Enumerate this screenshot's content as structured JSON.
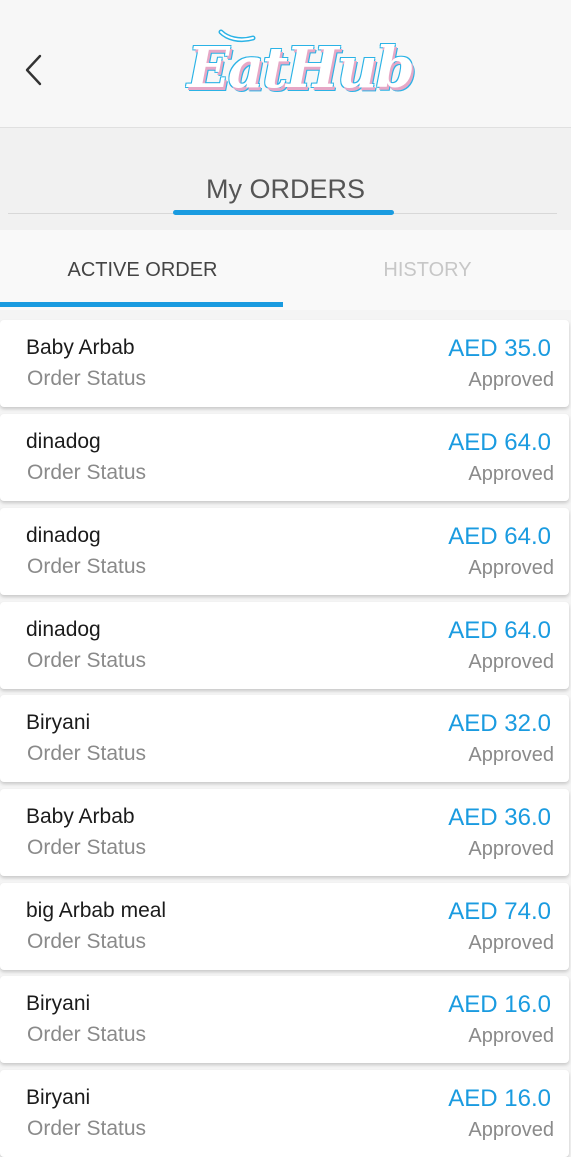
{
  "app": {
    "logo_text": "EatHub"
  },
  "header": {
    "back_icon": "chevron-left-icon"
  },
  "section": {
    "title": "My ORDERS"
  },
  "tabs": [
    {
      "label": "ACTIVE ORDER",
      "active": true
    },
    {
      "label": "HISTORY",
      "active": false
    }
  ],
  "colors": {
    "accent": "#1a9be0",
    "background": "#f4f4f4",
    "card": "#ffffff"
  },
  "orders": [
    {
      "name": "Baby Arbab",
      "status_label": "Order Status",
      "price": "AED 35.0",
      "status": "Approved"
    },
    {
      "name": "dinadog",
      "status_label": "Order Status",
      "price": "AED 64.0",
      "status": "Approved"
    },
    {
      "name": "dinadog",
      "status_label": "Order Status",
      "price": "AED 64.0",
      "status": "Approved"
    },
    {
      "name": "dinadog",
      "status_label": "Order Status",
      "price": "AED 64.0",
      "status": "Approved"
    },
    {
      "name": "Biryani",
      "status_label": "Order Status",
      "price": "AED 32.0",
      "status": "Approved"
    },
    {
      "name": "Baby Arbab",
      "status_label": "Order Status",
      "price": "AED 36.0",
      "status": "Approved"
    },
    {
      "name": "big Arbab meal",
      "status_label": "Order Status",
      "price": "AED 74.0",
      "status": "Approved"
    },
    {
      "name": "Biryani",
      "status_label": "Order Status",
      "price": "AED 16.0",
      "status": "Approved"
    },
    {
      "name": "Biryani",
      "status_label": "Order Status",
      "price": "AED 16.0",
      "status": "Approved"
    }
  ]
}
